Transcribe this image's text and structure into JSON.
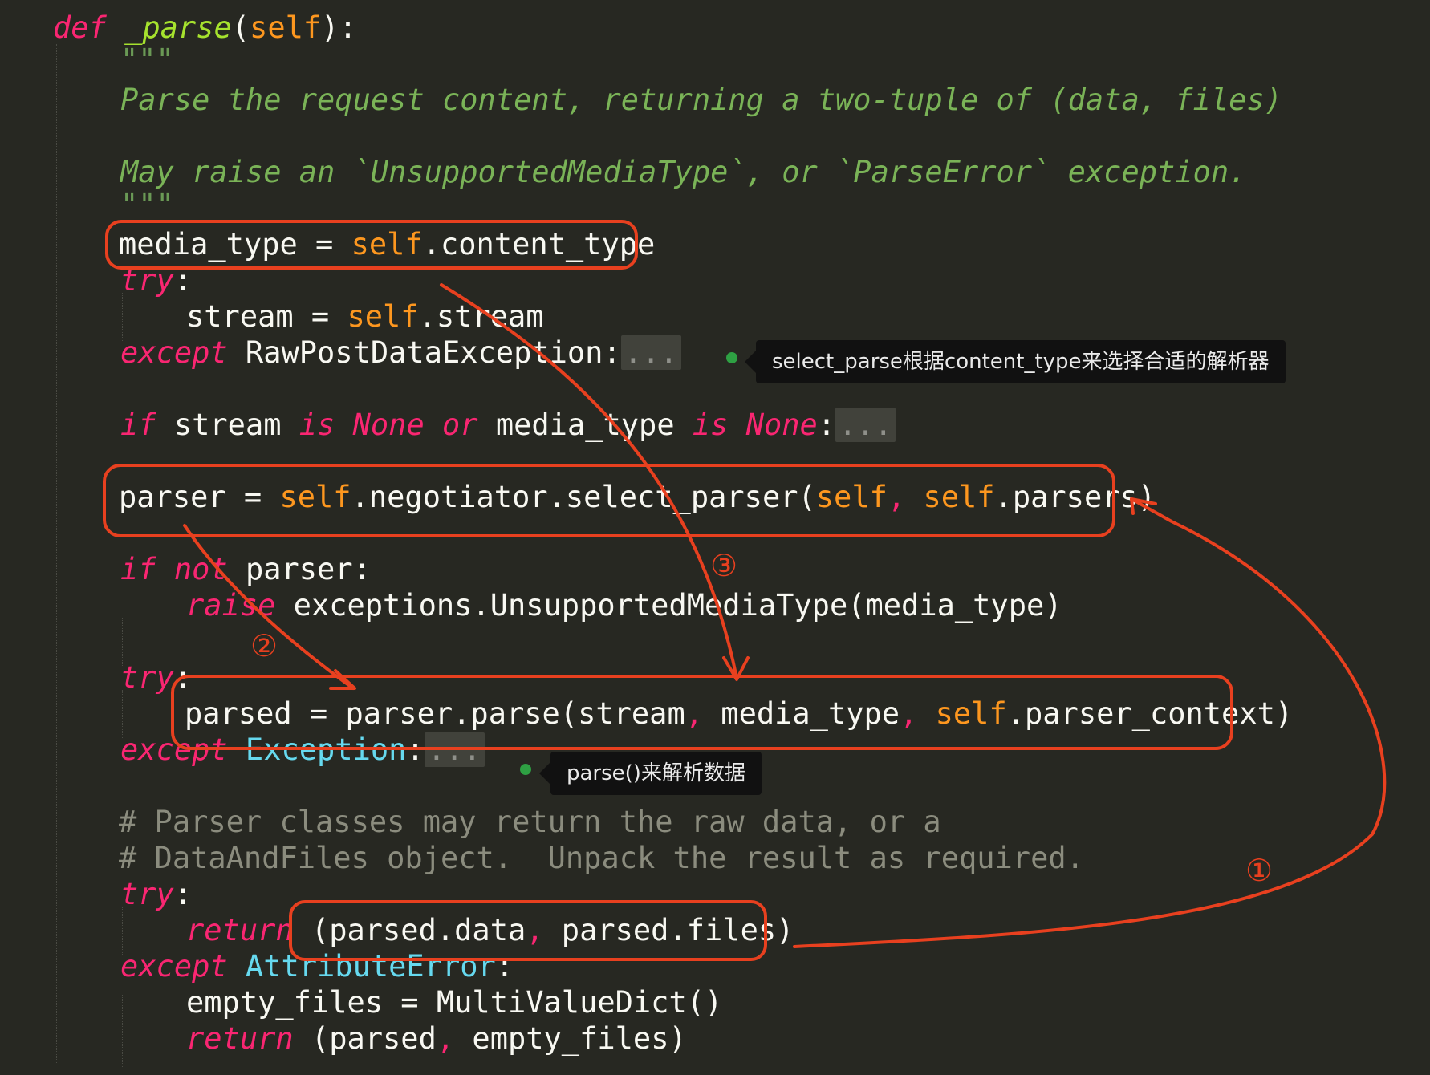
{
  "code": {
    "l1": {
      "kw": "def",
      "fn": "_parse",
      "open": "(",
      "self": "self",
      "close": "):"
    },
    "l2": "\"\"\"",
    "l3": "Parse the request content, returning a two-tuple of (data, files)",
    "l4": "May raise an `UnsupportedMediaType`, or `ParseError` exception.",
    "l5": "\"\"\"",
    "l6": {
      "a": "media_type = ",
      "self": "self",
      "b": ".content_type"
    },
    "l7": {
      "kw": "try",
      "b": ":"
    },
    "l8": {
      "a": "stream = ",
      "self": "self",
      "b": ".stream"
    },
    "l9": {
      "kw": "except",
      "a": " RawPostDataException:",
      "fold": "..."
    },
    "l10": {
      "if": "if",
      "a": " stream ",
      "is1": "is",
      "none1": " None",
      "or": " or",
      "b": " media_type ",
      "is2": "is",
      "none2": " None",
      "c": ":",
      "fold": "..."
    },
    "l11": {
      "a": "parser = ",
      "self1": "self",
      "b": ".negotiator.select_parser(",
      "self2": "self",
      "comma": ",",
      "self3": " self",
      "c": ".parsers)"
    },
    "l12": {
      "if": "if",
      "not": " not",
      "a": " parser:"
    },
    "l13": {
      "kw": "raise",
      "a": " exceptions.UnsupportedMediaType(media_type)"
    },
    "l14": {
      "kw": "try",
      "b": ":"
    },
    "l15": {
      "a": "parsed = parser.parse(stream",
      "c1": ",",
      "b": " media_type",
      "c2": ",",
      "self": " self",
      "c": ".parser_context)"
    },
    "l16": {
      "kw": "except",
      "cls": " Exception",
      "a": ":",
      "fold": "..."
    },
    "l17": "# Parser classes may return the raw data, or a",
    "l18": "# DataAndFiles object.  Unpack the result as required.",
    "l19": {
      "kw": "try",
      "b": ":"
    },
    "l20": {
      "kw": "return",
      "a": " (parsed.data",
      "c": ",",
      "b": " parsed.files)"
    },
    "l21": {
      "kw": "except",
      "cls": " AttributeError",
      "a": ":"
    },
    "l22": "empty_files = MultiValueDict()",
    "l23": {
      "kw": "return",
      "a": " (parsed",
      "c": ",",
      "b": " empty_files)"
    }
  },
  "tooltips": {
    "select_parser": "select_parse根据content_type来选择合适的解析器",
    "parse": "parse()来解析数据"
  },
  "annotations": {
    "step1": "①",
    "step2": "②",
    "step3": "③",
    "color": "#E8401F"
  },
  "colors": {
    "background": "#272822",
    "keyword": "#F92672",
    "function": "#A6E22E",
    "self": "#FD971F",
    "class": "#66D9EF",
    "docstring": "#6a9955",
    "comment": "#8b8c7e"
  }
}
